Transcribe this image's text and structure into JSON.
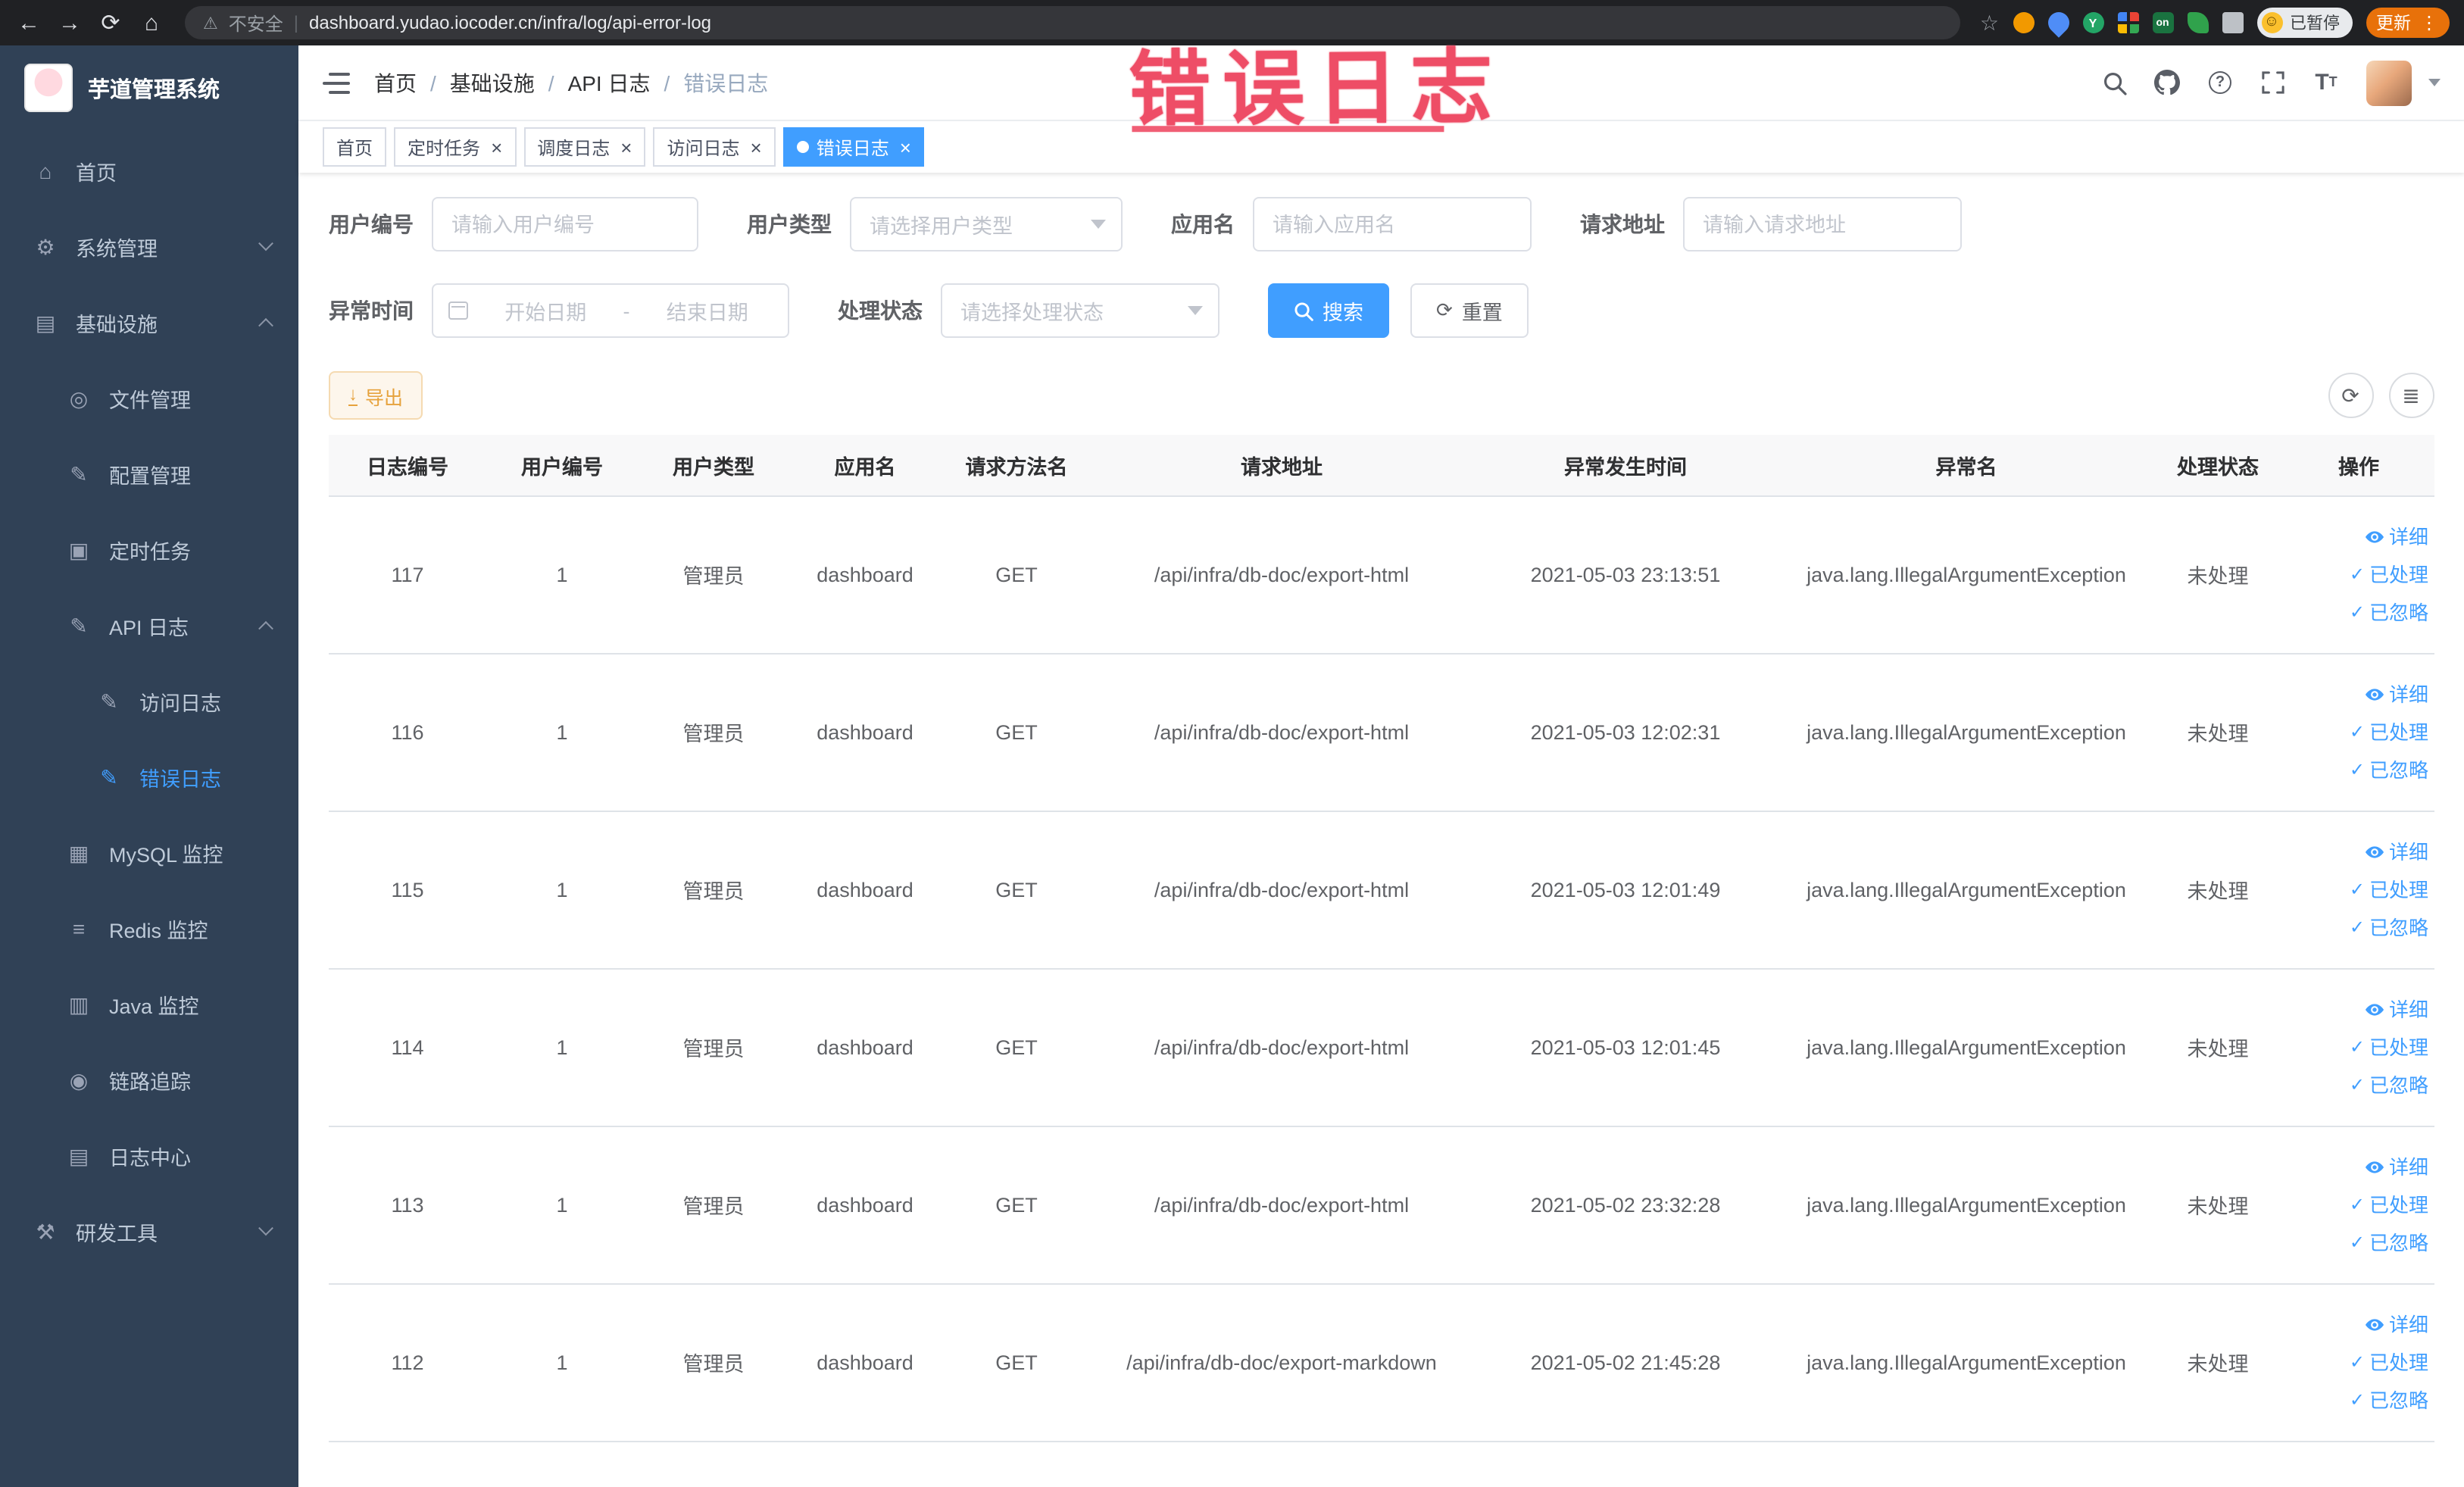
{
  "browser": {
    "security_label": "不安全",
    "url": "dashboard.yudao.iocoder.cn/infra/log/api-error-log",
    "profile_badge": "已暂停",
    "update_button": "更新"
  },
  "annotation": "错误日志",
  "colors": {
    "primary": "#409eff",
    "sidebar_bg": "#304156",
    "warning": "#e6a23c",
    "annotation_red": "#ee4d66",
    "tag_active": "#409eff"
  },
  "sidebar": {
    "logo_title": "芋道管理系统",
    "items": [
      {
        "name": "home",
        "label": "首页",
        "icon": "home",
        "depth": 0
      },
      {
        "name": "system-mgmt",
        "label": "系统管理",
        "icon": "gear",
        "depth": 0,
        "chevron": "down"
      },
      {
        "name": "infrastructure",
        "label": "基础设施",
        "icon": "infra",
        "depth": 0,
        "chevron": "up"
      },
      {
        "name": "file-mgmt",
        "label": "文件管理",
        "icon": "file",
        "depth": 1
      },
      {
        "name": "config-mgmt",
        "label": "配置管理",
        "icon": "config",
        "depth": 1
      },
      {
        "name": "scheduled-jobs",
        "label": "定时任务",
        "icon": "job",
        "depth": 1
      },
      {
        "name": "api-log",
        "label": "API 日志",
        "icon": "log",
        "depth": 1,
        "chevron": "up"
      },
      {
        "name": "access-log",
        "label": "访问日志",
        "icon": "log",
        "depth": 2
      },
      {
        "name": "error-log",
        "label": "错误日志",
        "icon": "log",
        "depth": 2,
        "active": true
      },
      {
        "name": "mysql-monitor",
        "label": "MySQL 监控",
        "icon": "mysql",
        "depth": 1
      },
      {
        "name": "redis-monitor",
        "label": "Redis 监控",
        "icon": "redis",
        "depth": 1
      },
      {
        "name": "java-monitor",
        "label": "Java 监控",
        "icon": "java",
        "depth": 1
      },
      {
        "name": "trace",
        "label": "链路追踪",
        "icon": "trace",
        "depth": 1
      },
      {
        "name": "log-center",
        "label": "日志中心",
        "icon": "logcenter",
        "depth": 1
      },
      {
        "name": "dev-tools",
        "label": "研发工具",
        "icon": "tool",
        "depth": 0,
        "chevron": "down"
      }
    ]
  },
  "navbar": {
    "breadcrumb": [
      "首页",
      "基础设施",
      "API 日志",
      "错误日志"
    ]
  },
  "tabs": [
    {
      "name": "home",
      "label": "首页",
      "closable": false,
      "active": false
    },
    {
      "name": "scheduled-jobs",
      "label": "定时任务",
      "closable": true,
      "active": false
    },
    {
      "name": "job-log",
      "label": "调度日志",
      "closable": true,
      "active": false
    },
    {
      "name": "access-log",
      "label": "访问日志",
      "closable": true,
      "active": false
    },
    {
      "name": "error-log",
      "label": "错误日志",
      "closable": true,
      "active": true
    }
  ],
  "filters": {
    "user_id": {
      "label": "用户编号",
      "placeholder": "请输入用户编号"
    },
    "user_type": {
      "label": "用户类型",
      "placeholder": "请选择用户类型"
    },
    "app_name": {
      "label": "应用名",
      "placeholder": "请输入应用名"
    },
    "request_url": {
      "label": "请求地址",
      "placeholder": "请输入请求地址"
    },
    "exception_time": {
      "label": "异常时间",
      "start_placeholder": "开始日期",
      "separator": "-",
      "end_placeholder": "结束日期"
    },
    "process_status": {
      "label": "处理状态",
      "placeholder": "请选择处理状态"
    },
    "search_button": "搜索",
    "reset_button": "重置"
  },
  "toolbar": {
    "export_button": "导出"
  },
  "table": {
    "columns": [
      "日志编号",
      "用户编号",
      "用户类型",
      "应用名",
      "请求方法名",
      "请求地址",
      "异常发生时间",
      "异常名",
      "处理状态",
      "操作"
    ],
    "actions": [
      "详细",
      "已处理",
      "已忽略"
    ],
    "rows": [
      {
        "id": "117",
        "user_id": "1",
        "user_type": "管理员",
        "app": "dashboard",
        "method": "GET",
        "url": "/api/infra/db-doc/export-html",
        "time": "2021-05-03 23:13:51",
        "exception": "java.lang.IllegalArgumentException",
        "status": "未处理"
      },
      {
        "id": "116",
        "user_id": "1",
        "user_type": "管理员",
        "app": "dashboard",
        "method": "GET",
        "url": "/api/infra/db-doc/export-html",
        "time": "2021-05-03 12:02:31",
        "exception": "java.lang.IllegalArgumentException",
        "status": "未处理"
      },
      {
        "id": "115",
        "user_id": "1",
        "user_type": "管理员",
        "app": "dashboard",
        "method": "GET",
        "url": "/api/infra/db-doc/export-html",
        "time": "2021-05-03 12:01:49",
        "exception": "java.lang.IllegalArgumentException",
        "status": "未处理"
      },
      {
        "id": "114",
        "user_id": "1",
        "user_type": "管理员",
        "app": "dashboard",
        "method": "GET",
        "url": "/api/infra/db-doc/export-html",
        "time": "2021-05-03 12:01:45",
        "exception": "java.lang.IllegalArgumentException",
        "status": "未处理"
      },
      {
        "id": "113",
        "user_id": "1",
        "user_type": "管理员",
        "app": "dashboard",
        "method": "GET",
        "url": "/api/infra/db-doc/export-html",
        "time": "2021-05-02 23:32:28",
        "exception": "java.lang.IllegalArgumentException",
        "status": "未处理"
      },
      {
        "id": "112",
        "user_id": "1",
        "user_type": "管理员",
        "app": "dashboard",
        "method": "GET",
        "url": "/api/infra/db-doc/export-markdown",
        "time": "2021-05-02 21:45:28",
        "exception": "java.lang.IllegalArgumentException",
        "status": "未处理"
      }
    ]
  }
}
